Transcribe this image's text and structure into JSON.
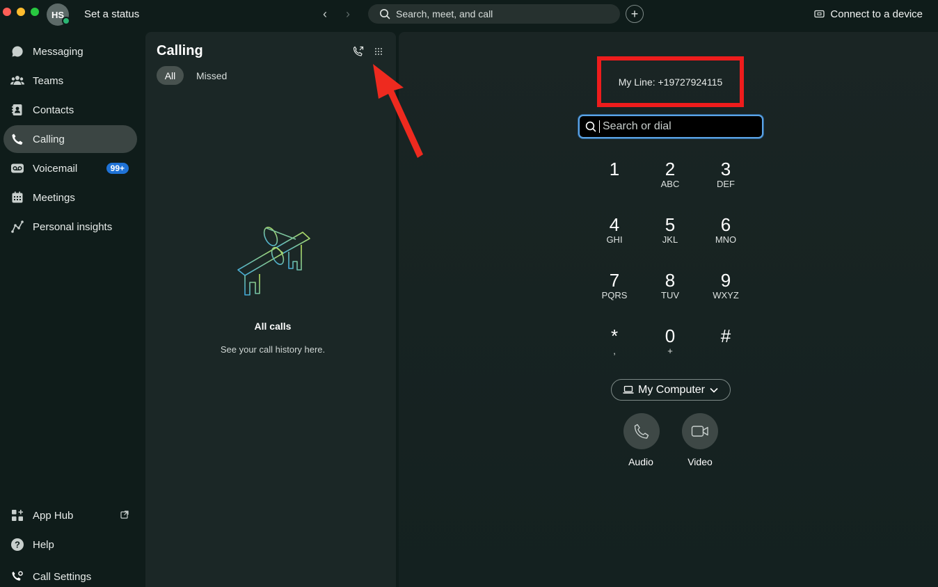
{
  "topbar": {
    "avatar_initials": "HS",
    "status_label": "Set a status",
    "search_placeholder": "Search, meet, and call",
    "connect_label": "Connect to a device"
  },
  "sidebar": {
    "items": [
      {
        "label": "Messaging",
        "icon": "chat-bubble-icon"
      },
      {
        "label": "Teams",
        "icon": "people-icon"
      },
      {
        "label": "Contacts",
        "icon": "contacts-book-icon"
      },
      {
        "label": "Calling",
        "icon": "phone-icon",
        "active": true
      },
      {
        "label": "Voicemail",
        "icon": "voicemail-icon",
        "badge": "99+"
      },
      {
        "label": "Meetings",
        "icon": "calendar-icon"
      },
      {
        "label": "Personal insights",
        "icon": "insights-icon"
      }
    ],
    "bottom": [
      {
        "label": "App Hub",
        "icon": "app-hub-icon"
      },
      {
        "label": "Help",
        "icon": "help-icon"
      },
      {
        "label": "Call Settings",
        "icon": "call-settings-icon"
      }
    ]
  },
  "calling_panel": {
    "title": "Calling",
    "filters": [
      "All",
      "Missed"
    ],
    "empty_title": "All calls",
    "empty_subtitle": "See your call history here."
  },
  "dialer": {
    "my_line": "My Line: +19727924115",
    "input_placeholder": "Search or dial",
    "keys": [
      {
        "num": "1",
        "letters": ""
      },
      {
        "num": "2",
        "letters": "ABC"
      },
      {
        "num": "3",
        "letters": "DEF"
      },
      {
        "num": "4",
        "letters": "GHI"
      },
      {
        "num": "5",
        "letters": "JKL"
      },
      {
        "num": "6",
        "letters": "MNO"
      },
      {
        "num": "7",
        "letters": "PQRS"
      },
      {
        "num": "8",
        "letters": "TUV"
      },
      {
        "num": "9",
        "letters": "WXYZ"
      },
      {
        "num": "*",
        "letters": ","
      },
      {
        "num": "0",
        "letters": "+"
      },
      {
        "num": "#",
        "letters": ""
      }
    ],
    "device_label": "My Computer",
    "audio_label": "Audio",
    "video_label": "Video"
  },
  "colors": {
    "highlight_box": "#ee1c1c",
    "annotation_arrow": "#ee2a1f",
    "accent_blue": "#1f72d6"
  }
}
